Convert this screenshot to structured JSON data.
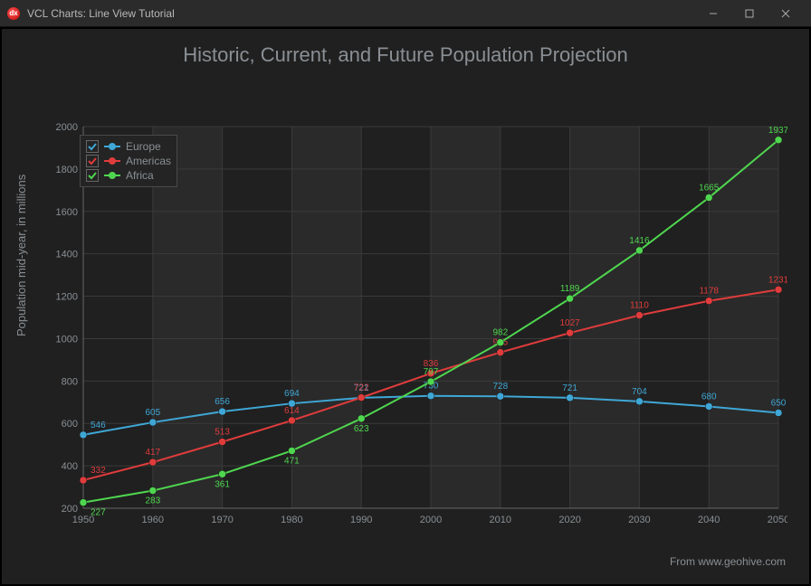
{
  "window": {
    "title": "VCL Charts: Line View Tutorial"
  },
  "chart": {
    "title": "Historic, Current, and Future Population Projection",
    "ylabel": "Population mid-year, in millions",
    "attribution": "From www.geohive.com"
  },
  "legend": {
    "items": [
      {
        "label": "Europe",
        "color": "#3fa7d6",
        "checked": true
      },
      {
        "label": "Americas",
        "color": "#e03c3c",
        "checked": true
      },
      {
        "label": "Africa",
        "color": "#4fd64f",
        "checked": true
      }
    ]
  },
  "chart_data": {
    "type": "line",
    "title": "Historic, Current, and Future Population Projection",
    "xlabel": "",
    "ylabel": "Population mid-year, in millions",
    "x": [
      1950,
      1960,
      1970,
      1980,
      1990,
      2000,
      2010,
      2020,
      2030,
      2040,
      2050
    ],
    "ylim": [
      200,
      2000
    ],
    "xlim": [
      1950,
      2050
    ],
    "yticks": [
      200,
      400,
      600,
      800,
      1000,
      1200,
      1400,
      1600,
      1800,
      2000
    ],
    "legend_position": "upper-left",
    "grid": true,
    "series": [
      {
        "name": "Europe",
        "color": "#3fa7d6",
        "values": [
          546,
          605,
          656,
          694,
          721,
          730,
          728,
          721,
          704,
          680,
          650
        ]
      },
      {
        "name": "Americas",
        "color": "#e03c3c",
        "values": [
          332,
          417,
          513,
          614,
          722,
          836,
          935,
          1027,
          1110,
          1178,
          1231
        ]
      },
      {
        "name": "Africa",
        "color": "#4fd64f",
        "values": [
          227,
          283,
          361,
          471,
          623,
          797,
          982,
          1189,
          1416,
          1665,
          1937
        ]
      }
    ]
  }
}
